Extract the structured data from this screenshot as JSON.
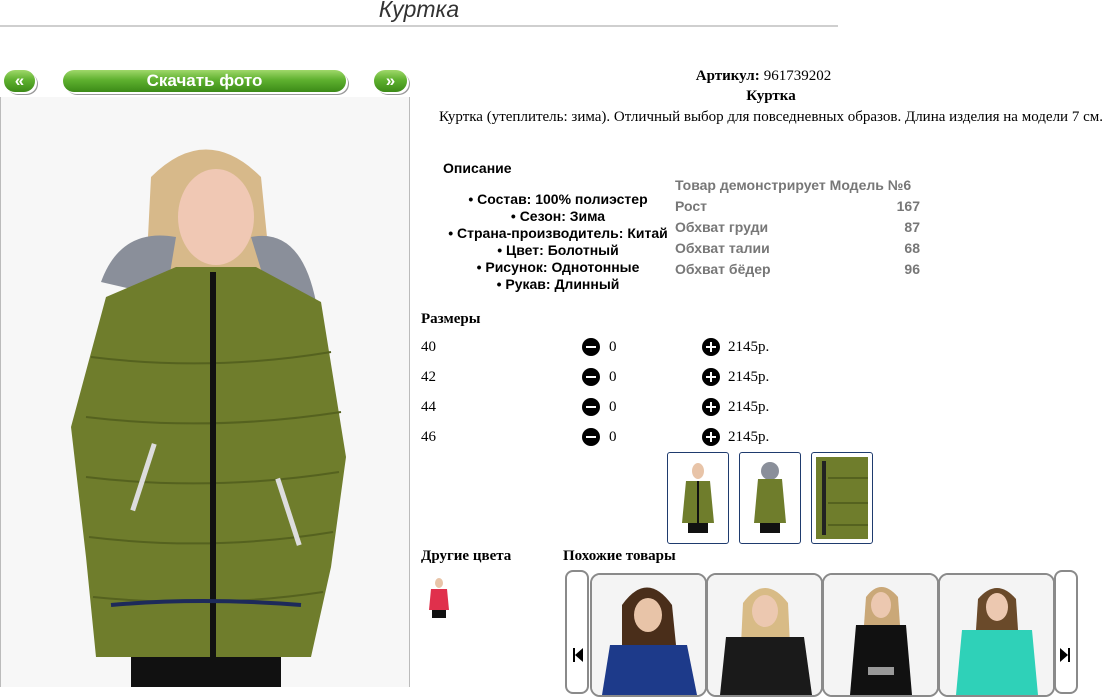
{
  "page_title": "Куртка",
  "nav": {
    "prev_label": "«",
    "download_label": "Скачать фото",
    "next_label": "»"
  },
  "product": {
    "article_label": "Артикул:",
    "article_value": "961739202",
    "name": "Куртка",
    "summary": "Куртка (утеплитель: зима). Отличный выбор для повседневных образов. Длина изделия на модели 7 см."
  },
  "description": {
    "heading": "Описание",
    "items": [
      "Состав: 100% полиэстер",
      "Сезон: Зима",
      "Страна-производитель: Китай",
      "Цвет: Болотный",
      "Рисунок: Однотонные",
      "Рукав: Длинный"
    ]
  },
  "model": {
    "heading": "Товар демонстрирует Модель №6",
    "rows": [
      {
        "label": "Рост",
        "value": "167"
      },
      {
        "label": "Обхват груди",
        "value": "87"
      },
      {
        "label": "Обхват талии",
        "value": "68"
      },
      {
        "label": "Обхват бёдер",
        "value": "96"
      }
    ]
  },
  "sizes": {
    "heading": "Размеры",
    "rows": [
      {
        "size": "40",
        "qty": "0",
        "price": "2145р."
      },
      {
        "size": "42",
        "qty": "0",
        "price": "2145р."
      },
      {
        "size": "44",
        "qty": "0",
        "price": "2145р."
      },
      {
        "size": "46",
        "qty": "0",
        "price": "2145р."
      }
    ]
  },
  "thumbnails": [
    "front-view",
    "back-view",
    "fabric-detail"
  ],
  "other_colors": {
    "heading": "Другие цвета"
  },
  "similar": {
    "heading": "Похожие товары"
  },
  "colors": {
    "button_green": "#5fb12f",
    "jacket_olive": "#6f7d2c",
    "thumb_border": "#1f3b6e",
    "measure_text": "#777777"
  }
}
